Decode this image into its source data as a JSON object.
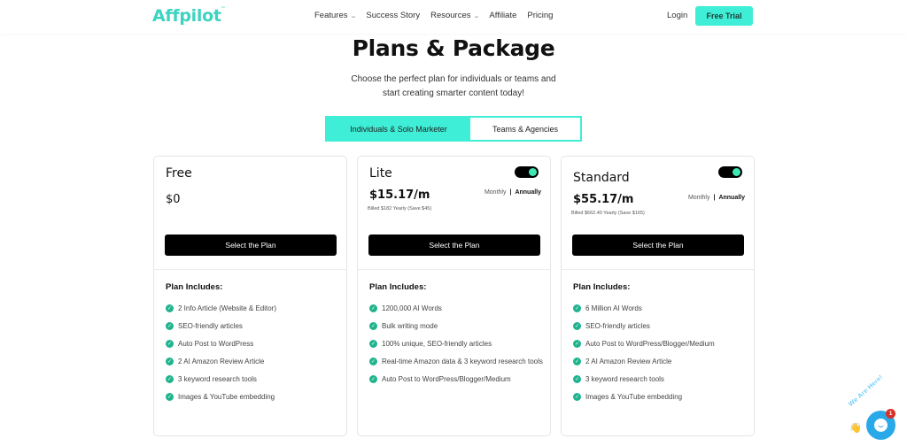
{
  "header": {
    "logo": "Affpilot",
    "logo_mark": "™",
    "nav": [
      {
        "label": "Features",
        "has_dropdown": true
      },
      {
        "label": "Success Story",
        "has_dropdown": false
      },
      {
        "label": "Resources",
        "has_dropdown": true
      },
      {
        "label": "Affiliate",
        "has_dropdown": false
      },
      {
        "label": "Pricing",
        "has_dropdown": false
      }
    ],
    "login_label": "Login",
    "cta_label": "Free Trial",
    "accent_color": "#3eeed6"
  },
  "hero": {
    "title": "Plans & Package",
    "subtitle_line1": "Choose the perfect plan for individuals or teams and",
    "subtitle_line2": "start creating smarter content today!"
  },
  "tabs": [
    {
      "label": "Individuals & Solo Marketer",
      "active": true
    },
    {
      "label": "Teams & Agencies",
      "active": false
    }
  ],
  "plans": [
    {
      "name": "Free",
      "price": "$0",
      "button_label": "Select the Plan",
      "includes_title": "Plan Includes:",
      "features": [
        "2 Info Article (Website & Editor)",
        "SEO-friendly articles",
        "Auto Post to WordPress",
        "2 AI Amazon Review Article",
        "3 keyword research tools",
        "Images & YouTube embedding"
      ]
    },
    {
      "name": "Lite",
      "price": "$15.17/m",
      "billed": "Billed $182 Yearly (Save $45)",
      "toggle_on": true,
      "period_monthly": "Monthly",
      "period_separator": "|",
      "period_annually": "Annually",
      "button_label": "Select the Plan",
      "includes_title": "Plan Includes:",
      "features": [
        "1200,000 AI Words",
        "Bulk writing mode",
        "100% unique, SEO-friendly articles",
        "Real-time Amazon data & 3 keyword research tools",
        "Auto Post to WordPress/Blogger/Medium"
      ]
    },
    {
      "name": "Standard",
      "price": "$55.17/m",
      "billed": "Billed $662.40 Yearly (Save $165)",
      "toggle_on": true,
      "period_monthly": "Monthly",
      "period_separator": "|",
      "period_annually": "Annually",
      "button_label": "Select the Plan",
      "includes_title": "Plan Includes:",
      "features": [
        "6 Million AI Words",
        "SEO-friendly articles",
        "Auto Post to WordPress/Blogger/Medium",
        "2 AI Amazon Review Article",
        "3 keyword research tools",
        "Images & YouTube embedding"
      ]
    }
  ],
  "chat_widget": {
    "label": "We Are Here!",
    "badge_count": "1",
    "wave_icon": "👋"
  },
  "icons": {
    "check": "✓",
    "chevron": "⌄"
  }
}
